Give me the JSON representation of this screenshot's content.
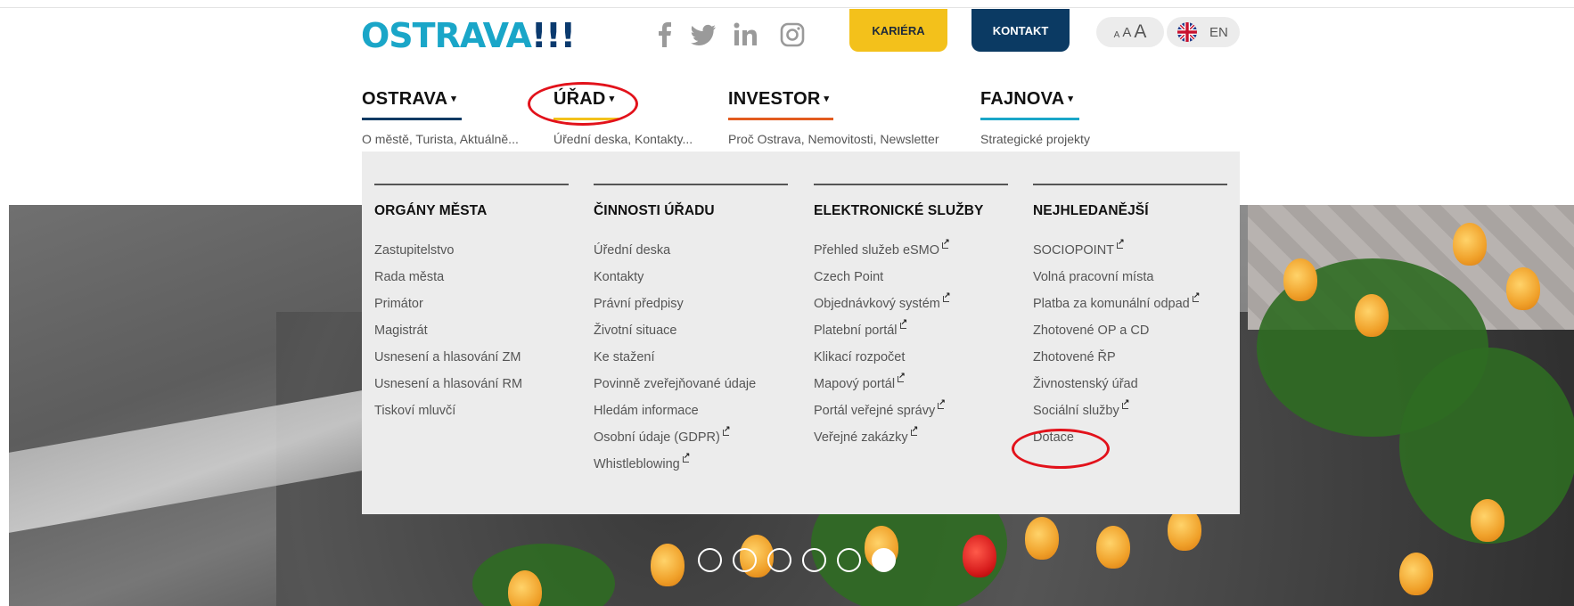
{
  "header": {
    "logo_text": "OSTRAVA",
    "logo_bang": "!!!",
    "social": [
      "facebook-icon",
      "twitter-icon",
      "linkedin-icon",
      "instagram-icon"
    ],
    "kariera_label": "KARIÉRA",
    "kontakt_label": "KONTAKT",
    "fontsize": [
      "A",
      "A",
      "A"
    ],
    "lang_label": "EN"
  },
  "colors": {
    "logo": "#1aa6c8",
    "kariera": "#f3c11b",
    "kontakt": "#0b3a63",
    "highlight_ellipse": "#e2121b"
  },
  "nav": [
    {
      "label": "OSTRAVA",
      "sub": "O městě, Turista, Aktuálně...",
      "underline": "#0b3a63"
    },
    {
      "label": "ÚŘAD",
      "sub": "Úřední deska, Kontakty...",
      "underline": "#f3c11b"
    },
    {
      "label": "INVESTOR",
      "sub": "Proč Ostrava, Nemovitosti, Newsletter",
      "underline": "#e25b1f"
    },
    {
      "label": "FAJNOVA",
      "sub": "Strategické projekty",
      "underline": "#1aa6c8"
    }
  ],
  "dropdown": {
    "columns": [
      {
        "heading": "ORGÁNY MĚSTA",
        "items": [
          {
            "label": "Zastupitelstvo",
            "external": false
          },
          {
            "label": "Rada města",
            "external": false
          },
          {
            "label": "Primátor",
            "external": false
          },
          {
            "label": "Magistrát",
            "external": false
          },
          {
            "label": "Usnesení a hlasování ZM",
            "external": false
          },
          {
            "label": "Usnesení a hlasování RM",
            "external": false
          },
          {
            "label": "Tiskoví mluvčí",
            "external": false
          }
        ]
      },
      {
        "heading": "ČINNOSTI ÚŘADU",
        "items": [
          {
            "label": "Úřední deska",
            "external": false
          },
          {
            "label": "Kontakty",
            "external": false
          },
          {
            "label": "Právní předpisy",
            "external": false
          },
          {
            "label": "Životní situace",
            "external": false
          },
          {
            "label": "Ke stažení",
            "external": false
          },
          {
            "label": "Povinně zveřejňované údaje",
            "external": false
          },
          {
            "label": "Hledám informace",
            "external": false
          },
          {
            "label": "Osobní údaje (GDPR)",
            "external": true
          },
          {
            "label": "Whistleblowing",
            "external": true
          }
        ]
      },
      {
        "heading": "ELEKTRONICKÉ SLUŽBY",
        "items": [
          {
            "label": "Přehled služeb eSMO",
            "external": true
          },
          {
            "label": "Czech Point",
            "external": false
          },
          {
            "label": "Objednávkový systém",
            "external": true
          },
          {
            "label": "Platební portál",
            "external": true
          },
          {
            "label": "Klikací rozpočet",
            "external": false
          },
          {
            "label": "Mapový portál",
            "external": true
          },
          {
            "label": "Portál veřejné správy",
            "external": true
          },
          {
            "label": "Veřejné zakázky",
            "external": true
          }
        ]
      },
      {
        "heading": "NEJHLEDANĚJŠÍ",
        "items": [
          {
            "label": "SOCIOPOINT",
            "external": true
          },
          {
            "label": "Volná pracovní místa",
            "external": false
          },
          {
            "label": "Platba za komunální odpad",
            "external": true
          },
          {
            "label": "Zhotovené OP a CD",
            "external": false
          },
          {
            "label": "Zhotovené ŘP",
            "external": false
          },
          {
            "label": "Živnostenský úřad",
            "external": false
          },
          {
            "label": "Sociální služby",
            "external": true
          },
          {
            "label": "Dotace",
            "external": false
          }
        ]
      }
    ]
  },
  "slider": {
    "count": 6,
    "active": 6
  }
}
